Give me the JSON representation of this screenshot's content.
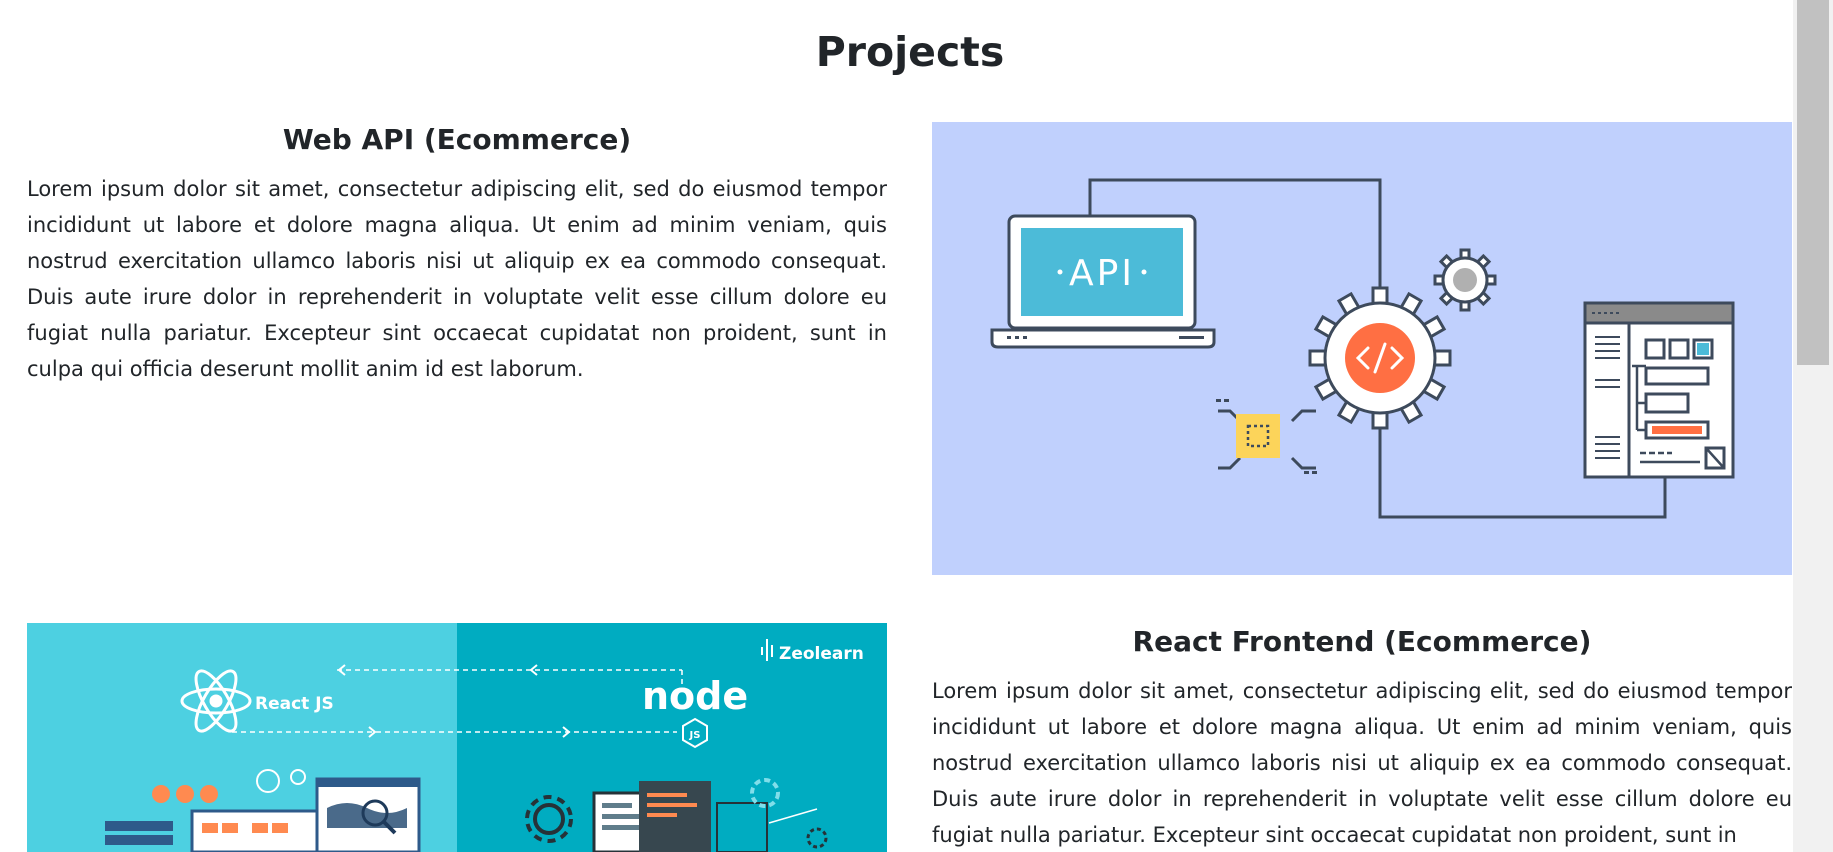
{
  "page": {
    "title": "Projects"
  },
  "projects": [
    {
      "title": "Web API (Ecommerce)",
      "description": "Lorem ipsum dolor sit amet, consectetur adipiscing elit, sed do eiusmod tempor incididunt ut labore et dolore magna aliqua. Ut enim ad minim veniam, quis nostrud exercitation ullamco laboris nisi ut aliquip ex ea commodo consequat. Duis aute irure dolor in reprehenderit in voluptate velit esse cillum dolore eu fugiat nulla pariatur. Excepteur sint occaecat cupidatat non proident, sunt in culpa qui officia deserunt mollit anim id est laborum.",
      "image_text": "API"
    },
    {
      "title": "React Frontend (Ecommerce)",
      "description": "Lorem ipsum dolor sit amet, consectetur adipiscing elit, sed do eiusmod tempor incididunt ut labore et dolore magna aliqua. Ut enim ad minim veniam, quis nostrud exercitation ullamco laboris nisi ut aliquip ex ea commodo consequat. Duis aute irure dolor in reprehenderit in voluptate velit esse cillum dolore eu fugiat nulla pariatur. Excepteur sint occaecat cupidatat non proident, sunt in",
      "image_labels": {
        "react": "React JS",
        "node": "node",
        "node_badge": "JS",
        "brand": "Zeolearn"
      }
    }
  ],
  "colors": {
    "api_bg": "#c0d0fd",
    "react_left_bg": "#4dd0e1",
    "react_right_bg": "#00acc1",
    "gear_orange": "#ff6f43",
    "chip_yellow": "#fcd45a",
    "screen_blue": "#4cbbd8"
  }
}
